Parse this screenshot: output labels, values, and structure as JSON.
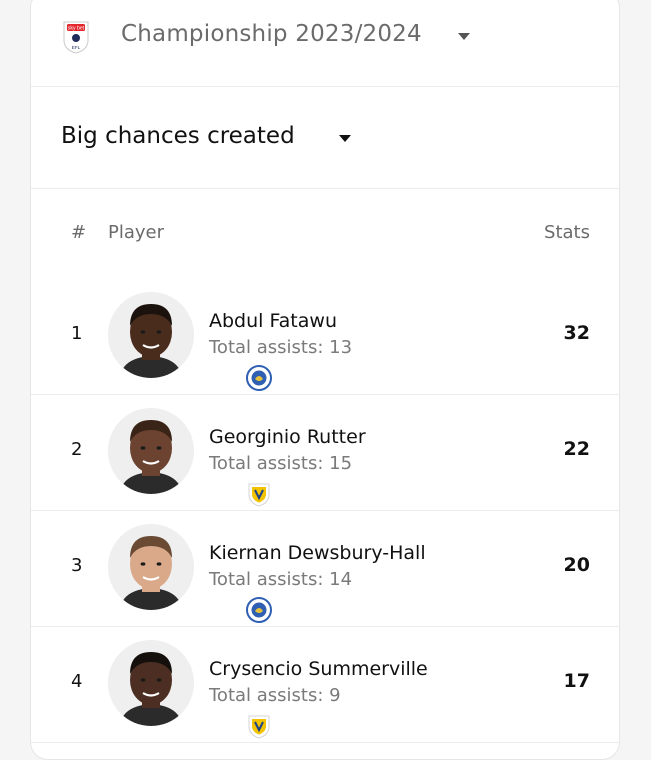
{
  "league": {
    "name": "Championship 2023/2024",
    "logo_icon": "efl-sky-bet-logo",
    "logo_text_top": "sky bet",
    "logo_text_bottom": "EFL"
  },
  "stat_selector": {
    "label": "Big chances created"
  },
  "table": {
    "headers": {
      "rank": "#",
      "player": "Player",
      "stats": "Stats"
    },
    "assists_label": "Total assists:",
    "rows": [
      {
        "rank": "1",
        "name": "Abdul Fatawu",
        "assists": "Total assists: 13",
        "stat": "32",
        "club_icon": "leicester-crest-icon",
        "club_color": "#2f5fb3",
        "skin": "#4a2c1d",
        "hair": "#1b120d"
      },
      {
        "rank": "2",
        "name": "Georginio Rutter",
        "assists": "Total assists: 15",
        "stat": "22",
        "club_icon": "leeds-crest-icon",
        "club_color": "#f2c300",
        "skin": "#6b4330",
        "hair": "#3a2418"
      },
      {
        "rank": "3",
        "name": "Kiernan Dewsbury-Hall",
        "assists": "Total assists: 14",
        "stat": "20",
        "club_icon": "leicester-crest-icon",
        "club_color": "#2f5fb3",
        "skin": "#d9a98a",
        "hair": "#6a4a33"
      },
      {
        "rank": "4",
        "name": "Crysencio Summerville",
        "assists": "Total assists: 9",
        "stat": "17",
        "club_icon": "leeds-crest-icon",
        "club_color": "#f2c300",
        "skin": "#4c2f22",
        "hair": "#15100c"
      }
    ]
  }
}
